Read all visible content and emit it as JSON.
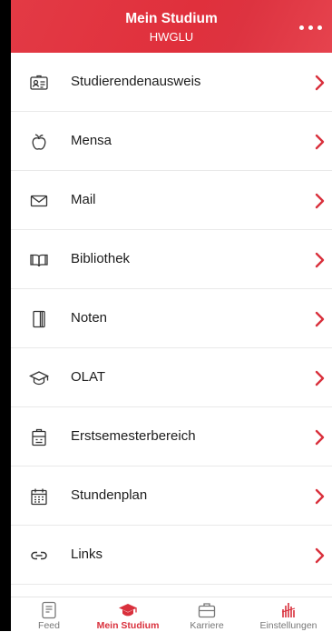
{
  "header": {
    "title": "Mein Studium",
    "subtitle": "HWGLU",
    "more_icon": "more-horizontal-icon"
  },
  "menu": {
    "items": [
      {
        "label": "Studierendenausweis",
        "icon": "id-card-icon"
      },
      {
        "label": "Mensa",
        "icon": "apple-icon"
      },
      {
        "label": "Mail",
        "icon": "mail-icon"
      },
      {
        "label": "Bibliothek",
        "icon": "book-open-icon"
      },
      {
        "label": "Noten",
        "icon": "notebook-icon"
      },
      {
        "label": "OLAT",
        "icon": "graduation-cap-icon"
      },
      {
        "label": "Erstsemesterbereich",
        "icon": "badge-icon"
      },
      {
        "label": "Stundenplan",
        "icon": "calendar-icon"
      },
      {
        "label": "Links",
        "icon": "link-icon"
      }
    ]
  },
  "tabbar": {
    "tabs": [
      {
        "label": "Feed",
        "icon": "feed-icon",
        "active": false
      },
      {
        "label": "Mein Studium",
        "icon": "graduation-cap-icon",
        "active": true
      },
      {
        "label": "Karriere",
        "icon": "briefcase-icon",
        "active": false
      },
      {
        "label": "Einstellungen",
        "icon": "settings-logo-icon",
        "active": false
      }
    ]
  },
  "colors": {
    "accent": "#e0303c",
    "divider": "#e9e9e9",
    "text": "#1c1c1c",
    "inactive": "#777777"
  }
}
